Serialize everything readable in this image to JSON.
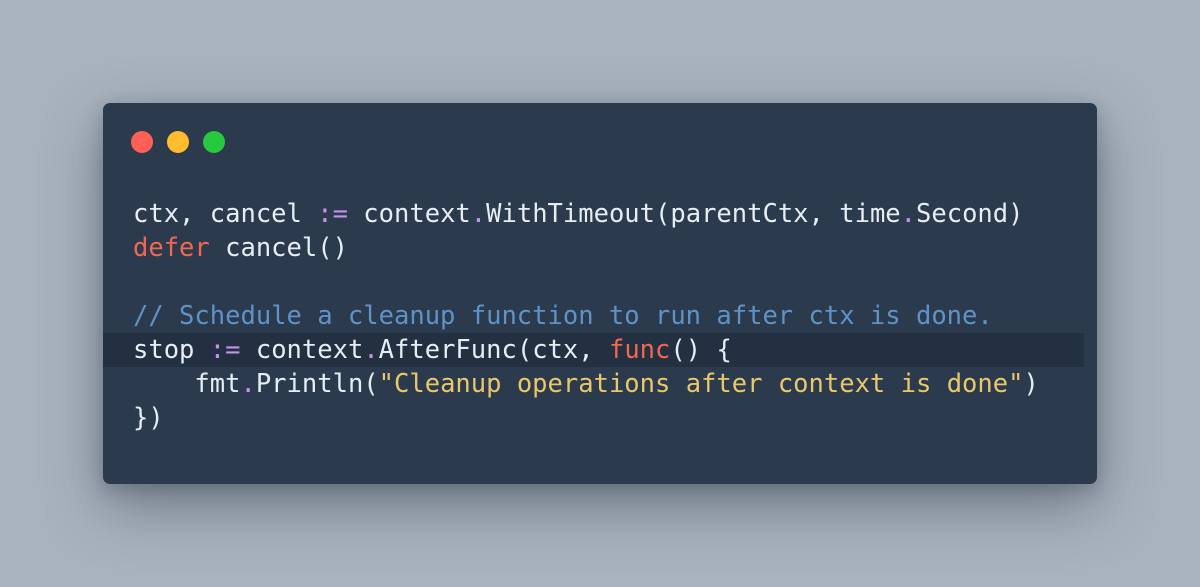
{
  "window": {
    "controls": [
      "close",
      "minimize",
      "maximize"
    ],
    "colors": {
      "background": "#2b3a4d",
      "page_background": "#a9b3bf",
      "close": "#ff5f56",
      "minimize": "#ffbd2e",
      "maximize": "#27c93f",
      "keyword": "#f2674f",
      "operator": "#c792ea",
      "comment": "#5f93c7",
      "string": "#e8c86a",
      "text": "#e6edf3"
    }
  },
  "code": {
    "language": "go",
    "lines": [
      [
        {
          "t": "ctx, cancel ",
          "c": "plain"
        },
        {
          "t": ":=",
          "c": "op"
        },
        {
          "t": " context",
          "c": "plain"
        },
        {
          "t": ".",
          "c": "op"
        },
        {
          "t": "WithTimeout(parentCtx, time",
          "c": "plain"
        },
        {
          "t": ".",
          "c": "op"
        },
        {
          "t": "Second)",
          "c": "plain"
        }
      ],
      [
        {
          "t": "defer",
          "c": "kw"
        },
        {
          "t": " cancel()",
          "c": "plain"
        }
      ],
      [],
      [
        {
          "t": "// Schedule a cleanup function to run after ctx is done.",
          "c": "comment"
        }
      ],
      [
        {
          "t": "stop ",
          "c": "plain"
        },
        {
          "t": ":=",
          "c": "op"
        },
        {
          "t": " context",
          "c": "plain"
        },
        {
          "t": ".",
          "c": "op"
        },
        {
          "t": "AfterFunc(ctx, ",
          "c": "plain"
        },
        {
          "t": "func",
          "c": "kw"
        },
        {
          "t": "() {",
          "c": "plain"
        }
      ],
      [
        {
          "t": "    fmt",
          "c": "plain"
        },
        {
          "t": ".",
          "c": "op"
        },
        {
          "t": "Println(",
          "c": "plain"
        },
        {
          "t": "\"Cleanup operations after context is done\"",
          "c": "str"
        },
        {
          "t": ")",
          "c": "plain"
        }
      ],
      [
        {
          "t": "})",
          "c": "plain"
        }
      ]
    ],
    "active_line": 4
  }
}
